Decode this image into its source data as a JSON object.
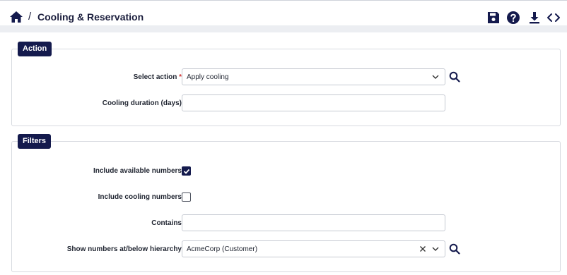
{
  "header": {
    "separator": "/",
    "title": "Cooling & Reservation"
  },
  "toolbar": {
    "icons": [
      "save-icon",
      "help-icon",
      "download-icon",
      "code-icon"
    ]
  },
  "action_panel": {
    "legend": "Action",
    "select_action_label": "Select action",
    "required_marker": "*",
    "select_action_value": "Apply cooling",
    "cooling_duration_label": "Cooling duration (days)",
    "cooling_duration_value": ""
  },
  "filters_panel": {
    "legend": "Filters",
    "include_available_label": "Include available numbers",
    "include_available_checked": true,
    "include_cooling_label": "Include cooling numbers",
    "include_cooling_checked": false,
    "contains_label": "Contains",
    "contains_value": "",
    "hierarchy_label": "Show numbers at/below hierarchy",
    "hierarchy_value": "AcmeCorp (Customer)"
  },
  "colors": {
    "accent": "#141a4d",
    "required": "#d03030"
  }
}
